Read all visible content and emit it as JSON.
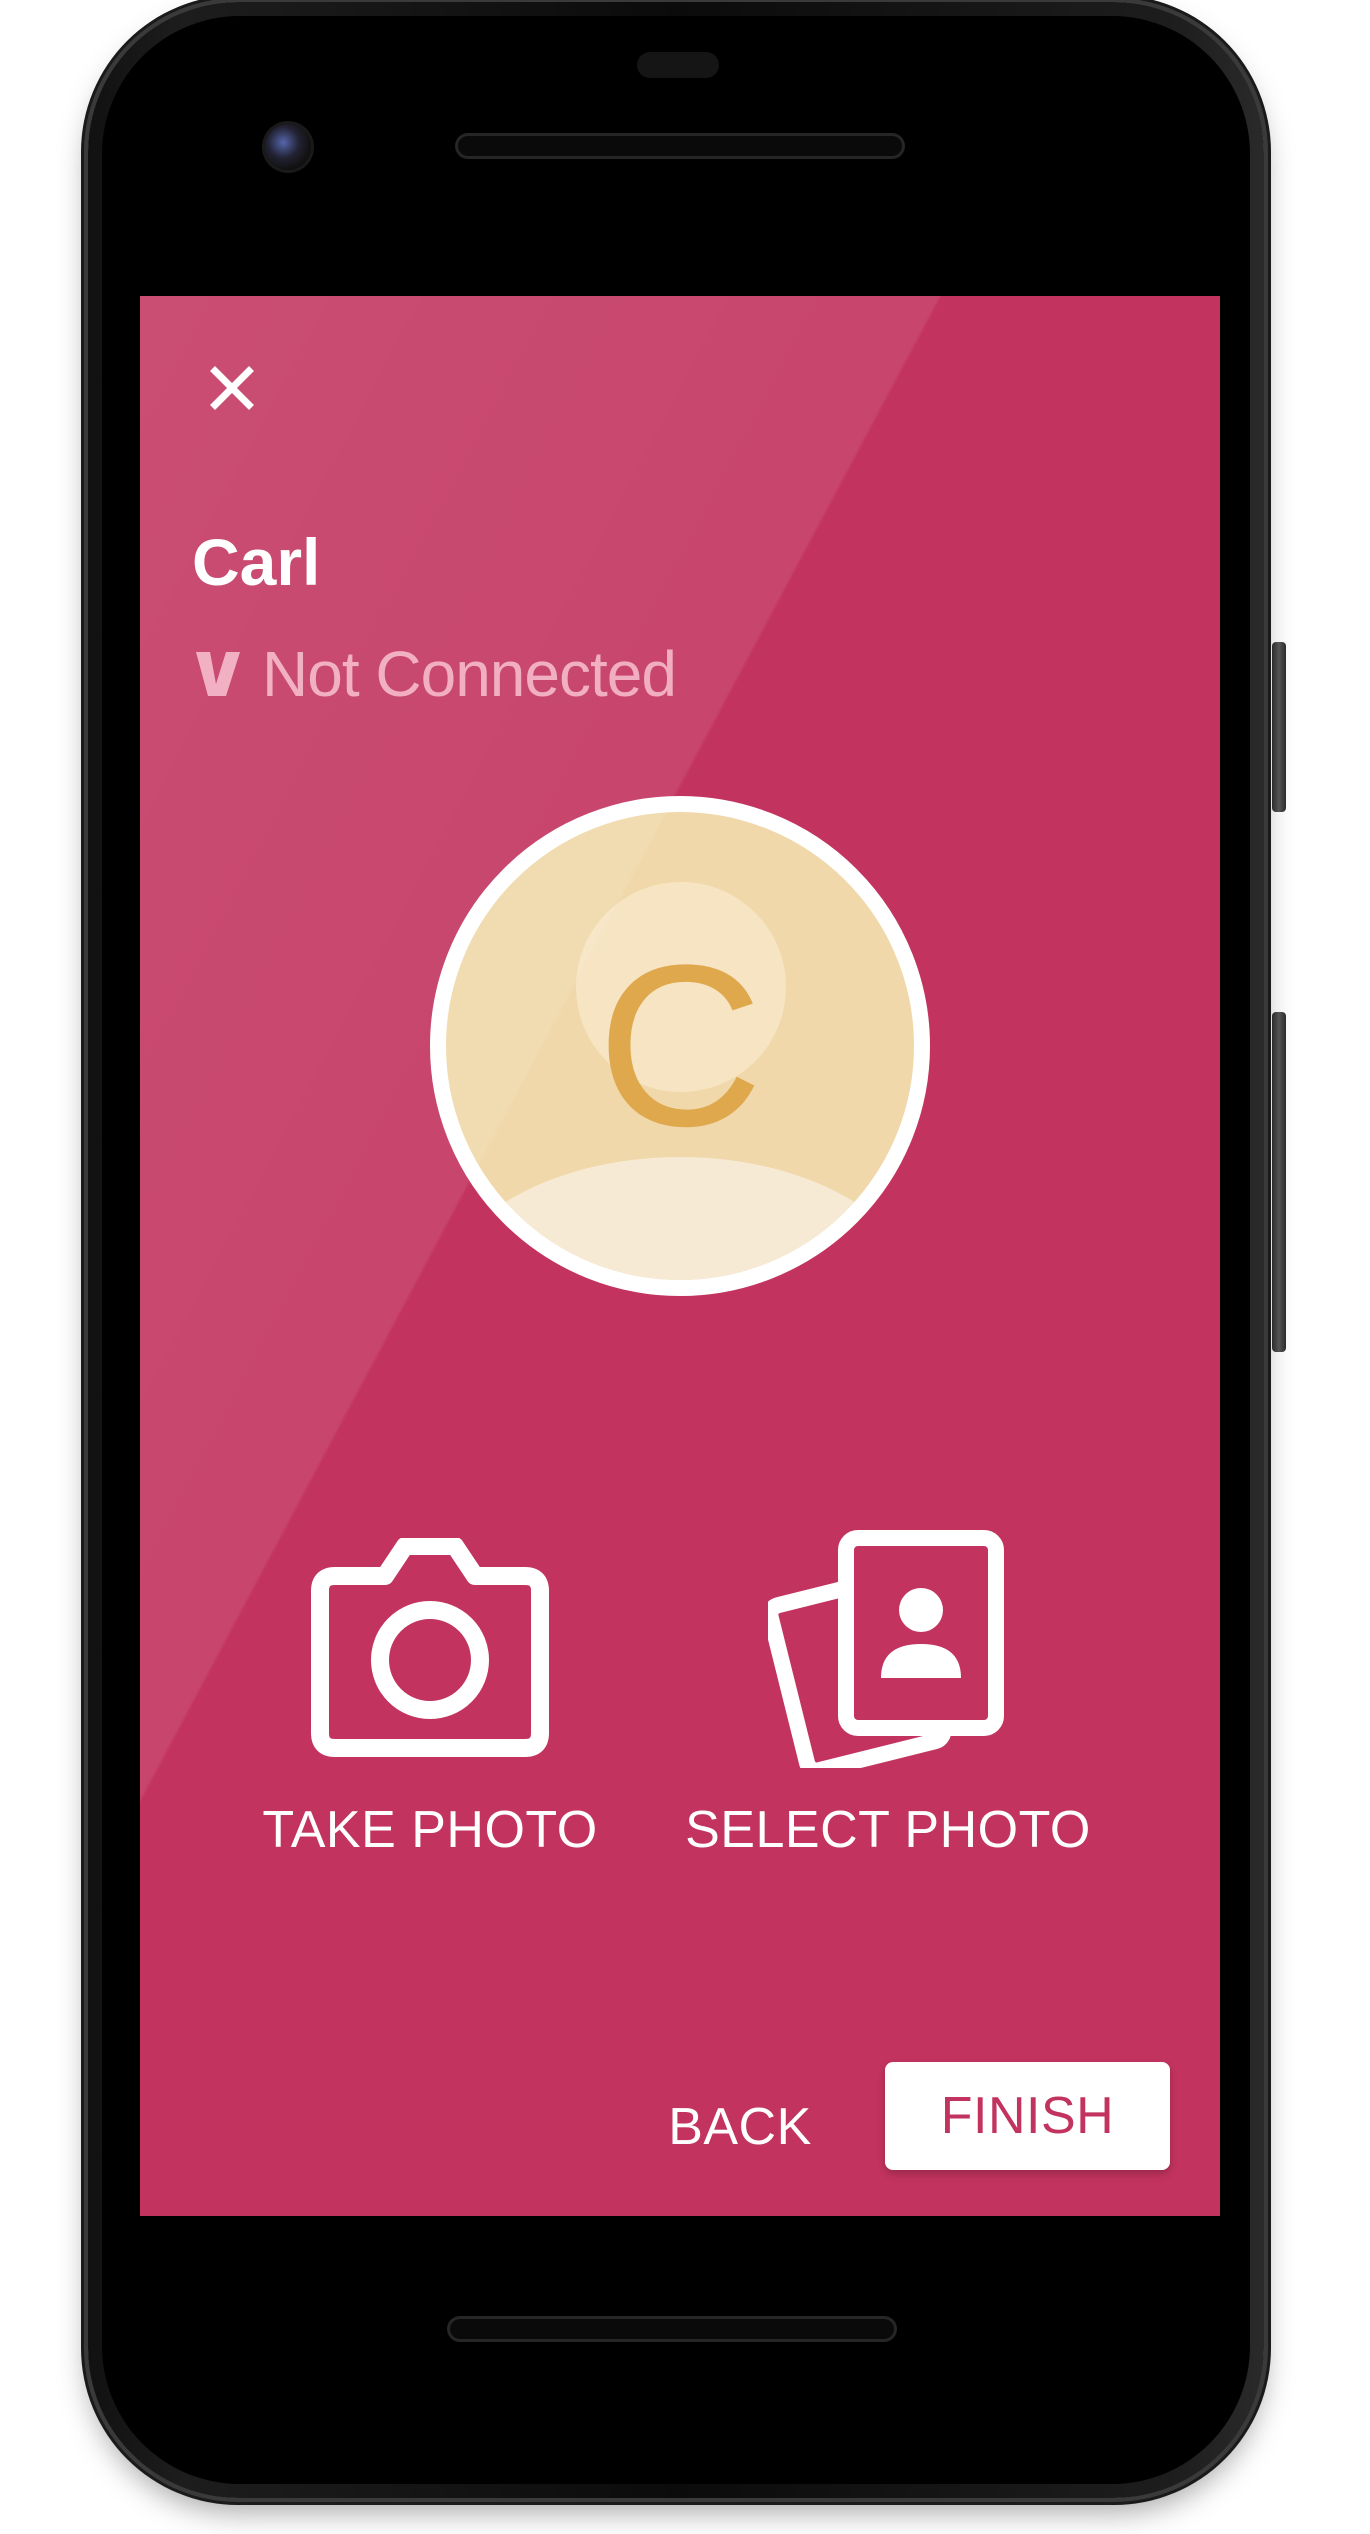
{
  "colors": {
    "background": "#c2335f",
    "accent": "#c2335f",
    "avatar_fill": "#f0d8aa",
    "avatar_initial": "#dfa84d",
    "status_text": "#f0a6bd"
  },
  "header": {
    "close_icon": "close-icon"
  },
  "contact": {
    "name": "Carl",
    "status_icon": "brand-v-icon",
    "status": "Not Connected",
    "avatar_initial": "C"
  },
  "actions": {
    "take_photo": {
      "icon": "camera-icon",
      "label": "TAKE PHOTO"
    },
    "select_photo": {
      "icon": "photo-stack-icon",
      "label": "SELECT PHOTO"
    }
  },
  "footer": {
    "back_label": "BACK",
    "finish_label": "FINISH"
  }
}
